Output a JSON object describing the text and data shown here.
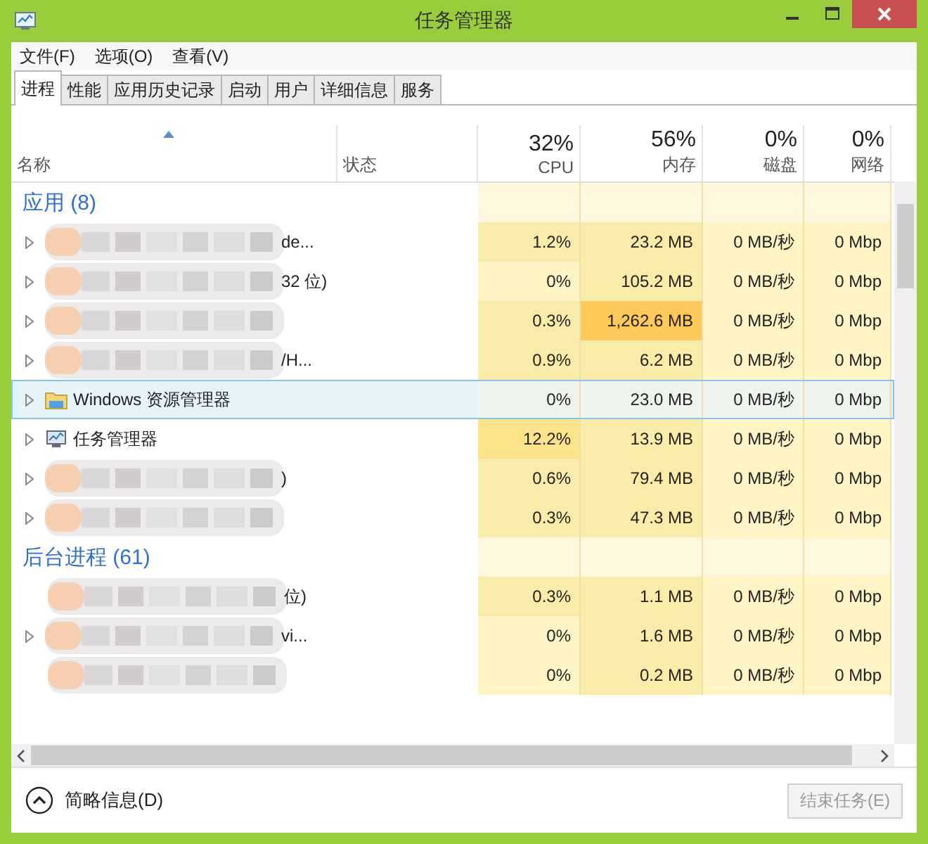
{
  "window": {
    "title": "任务管理器"
  },
  "menu": [
    "文件(F)",
    "选项(O)",
    "查看(V)"
  ],
  "tabs": [
    {
      "label": "进程",
      "selected": true
    },
    {
      "label": "性能",
      "selected": false
    },
    {
      "label": "应用历史记录",
      "selected": false
    },
    {
      "label": "启动",
      "selected": false
    },
    {
      "label": "用户",
      "selected": false
    },
    {
      "label": "详细信息",
      "selected": false
    },
    {
      "label": "服务",
      "selected": false
    }
  ],
  "columns": [
    {
      "kind": "name",
      "label": "名称"
    },
    {
      "kind": "status",
      "label": "状态"
    },
    {
      "kind": "metric",
      "total": "32%",
      "label": "CPU"
    },
    {
      "kind": "metric",
      "total": "56%",
      "label": "内存"
    },
    {
      "kind": "metric",
      "total": "0%",
      "label": "磁盘"
    },
    {
      "kind": "metric",
      "total": "0%",
      "label": "网络"
    }
  ],
  "rows": [
    {
      "kind": "group",
      "name": "应用 (8)"
    },
    {
      "kind": "blurred",
      "name": "de...",
      "expandable": true,
      "selected": false,
      "cells": [
        {
          "text": "1.2%",
          "color": "#f9eba8"
        },
        {
          "text": "23.2 MB",
          "color": "#f9eba8"
        },
        {
          "text": "0 MB/秒",
          "color": "#fff4c4"
        },
        {
          "text": "0 Mbp",
          "color": "#fff4c4"
        }
      ]
    },
    {
      "kind": "blurred",
      "name": "32 位)",
      "expandable": true,
      "selected": false,
      "cells": [
        {
          "text": "0%",
          "color": "#fff4c4"
        },
        {
          "text": "105.2 MB",
          "color": "#f9eba8"
        },
        {
          "text": "0 MB/秒",
          "color": "#fff4c4"
        },
        {
          "text": "0 Mbp",
          "color": "#fff4c4"
        }
      ]
    },
    {
      "kind": "blurred",
      "expandable": true,
      "selected": false,
      "cells": [
        {
          "text": "0.3%",
          "color": "#f9eba8"
        },
        {
          "text": "1,262.6 MB",
          "color": "#fcc95a"
        },
        {
          "text": "0 MB/秒",
          "color": "#fff4c4"
        },
        {
          "text": "0 Mbp",
          "color": "#fff4c4"
        }
      ]
    },
    {
      "kind": "blurred",
      "name": "/H...",
      "expandable": true,
      "selected": false,
      "cells": [
        {
          "text": "0.9%",
          "color": "#f9eba8"
        },
        {
          "text": "6.2 MB",
          "color": "#f9eba8"
        },
        {
          "text": "0 MB/秒",
          "color": "#fff4c4"
        },
        {
          "text": "0 Mbp",
          "color": "#fff4c4"
        }
      ]
    },
    {
      "kind": "folder",
      "name": "Windows 资源管理器",
      "expandable": true,
      "selected": true,
      "cells": [
        {
          "text": "0%",
          "color": "#eef3ee"
        },
        {
          "text": "23.0 MB",
          "color": "#eef3ee"
        },
        {
          "text": "0 MB/秒",
          "color": "#eef3ee"
        },
        {
          "text": "0 Mbp",
          "color": "#eef3ee"
        }
      ]
    },
    {
      "kind": "monitor",
      "name": "任务管理器",
      "expandable": true,
      "selected": false,
      "cells": [
        {
          "text": "12.2%",
          "color": "#fde38a"
        },
        {
          "text": "13.9 MB",
          "color": "#f9eba8"
        },
        {
          "text": "0 MB/秒",
          "color": "#fff4c4"
        },
        {
          "text": "0 Mbp",
          "color": "#fff4c4"
        }
      ]
    },
    {
      "kind": "blurred",
      "name": ")",
      "expandable": true,
      "selected": false,
      "cells": [
        {
          "text": "0.6%",
          "color": "#f9eba8"
        },
        {
          "text": "79.4 MB",
          "color": "#f9eba8"
        },
        {
          "text": "0 MB/秒",
          "color": "#fff4c4"
        },
        {
          "text": "0 Mbp",
          "color": "#fff4c4"
        }
      ]
    },
    {
      "kind": "blurred",
      "expandable": true,
      "selected": false,
      "cells": [
        {
          "text": "0.3%",
          "color": "#f9eba8"
        },
        {
          "text": "47.3 MB",
          "color": "#f9eba8"
        },
        {
          "text": "0 MB/秒",
          "color": "#fff4c4"
        },
        {
          "text": "0 Mbp",
          "color": "#fff4c4"
        }
      ]
    },
    {
      "kind": "group",
      "name": "后台进程 (61)"
    },
    {
      "kind": "blurred",
      "name": "位)",
      "expandable": false,
      "selected": false,
      "cells": [
        {
          "text": "0.3%",
          "color": "#f9eba8"
        },
        {
          "text": "1.1 MB",
          "color": "#f9eba8"
        },
        {
          "text": "0 MB/秒",
          "color": "#fff4c4"
        },
        {
          "text": "0 Mbp",
          "color": "#fff4c4"
        }
      ]
    },
    {
      "kind": "blurred",
      "name": "vi...",
      "expandable": true,
      "selected": false,
      "cells": [
        {
          "text": "0%",
          "color": "#fff4c4"
        },
        {
          "text": "1.6 MB",
          "color": "#f9eba8"
        },
        {
          "text": "0 MB/秒",
          "color": "#fff4c4"
        },
        {
          "text": "0 Mbp",
          "color": "#fff4c4"
        }
      ]
    },
    {
      "kind": "blurred",
      "expandable": false,
      "selected": false,
      "cells": [
        {
          "text": "0%",
          "color": "#fff4c4"
        },
        {
          "text": "0.2 MB",
          "color": "#f9eba8"
        },
        {
          "text": "0 MB/秒",
          "color": "#fff4c4"
        },
        {
          "text": "0 Mbp",
          "color": "#fff4c4"
        }
      ]
    }
  ],
  "footer": {
    "details": "简略信息(D)",
    "end_task": {
      "label": "结束任务(E)",
      "disabled": true
    }
  }
}
